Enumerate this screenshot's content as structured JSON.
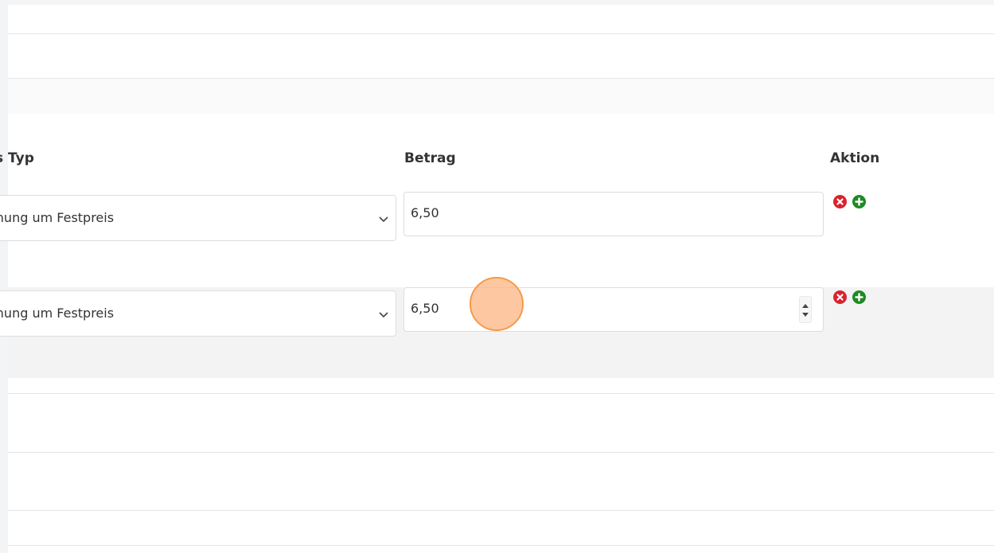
{
  "table": {
    "headers": {
      "typ": "s Typ",
      "betrag": "Betrag",
      "aktion": "Aktion"
    },
    "rows": [
      {
        "typ_value": "Erhöhung um Festpreis",
        "typ_visible": "öhung um Festpreis",
        "betrag_value": "6,50",
        "focused": false
      },
      {
        "typ_value": "Erhöhung um Festpreis",
        "typ_visible": "öhung um Festpreis",
        "betrag_value": "6,50",
        "focused": true
      }
    ]
  },
  "icons": {
    "chevron": "chevron-down-icon",
    "remove": "remove-circle-icon",
    "add": "add-circle-icon"
  },
  "colors": {
    "remove": "#d9232e",
    "add": "#1f8a23",
    "cursor_highlight": "#f59a4a"
  }
}
